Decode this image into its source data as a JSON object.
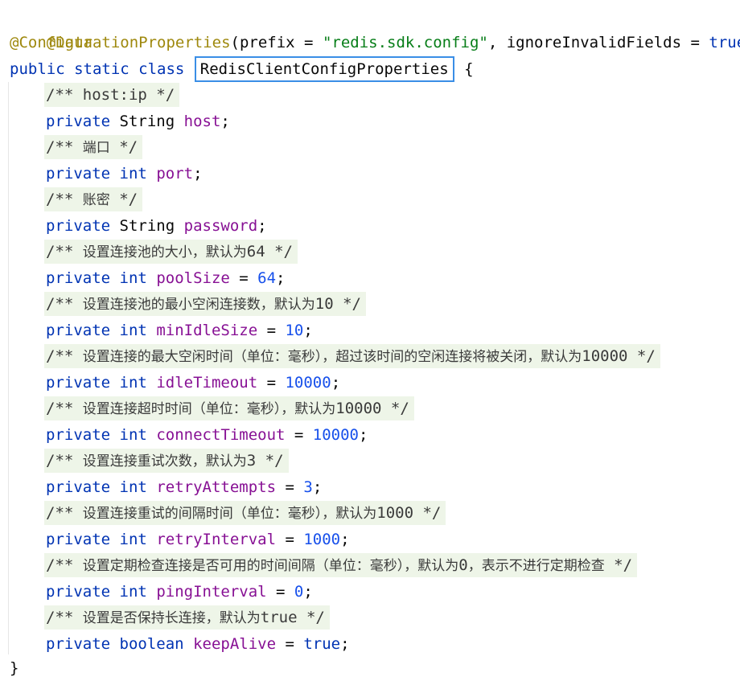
{
  "code": {
    "annotation_data": "@Data",
    "annotation_config": "@ConfigurationProperties",
    "prefix_open": "(prefix = ",
    "prefix_value": "\"redis.sdk.config\"",
    "ignore_part": ", ignoreInvalidFields = ",
    "ignore_value": "true",
    "close_paren": ")",
    "class_modifiers": "public static class ",
    "class_name": "RedisClientConfigProperties",
    "open_brace": " {",
    "close_brace": "}",
    "kw_private": "private",
    "kw_int": "int",
    "kw_boolean": "boolean",
    "type_string": "String",
    "eq": " = ",
    "semi": ";",
    "true_value": "true",
    "c_open": "/** ",
    "c_close": " */",
    "comments": {
      "host": "host:ip",
      "port": "端口",
      "password": "账密",
      "pool_size_text": "设置连接池的大小，默认为",
      "pool_size_num": "64",
      "min_idle_text": "设置连接池的最小空闲连接数，默认为",
      "min_idle_num": "10",
      "idle_timeout_text": "设置连接的最大空闲时间（单位：毫秒），超过该时间的空闲连接将被关闭，默认为",
      "idle_timeout_num": "10000",
      "connect_timeout_text": "设置连接超时时间（单位：毫秒），默认为",
      "connect_timeout_num": "10000",
      "retry_attempts_text": "设置连接重试次数，默认为",
      "retry_attempts_num": "3",
      "retry_interval_text": "设置连接重试的间隔时间（单位：毫秒），默认为",
      "retry_interval_num": "1000",
      "ping_interval_text": "设置定期检查连接是否可用的时间间隔（单位：毫秒），默认为",
      "ping_interval_num": "0",
      "ping_interval_text2": "，表示不进行定期检查",
      "keep_alive_text": "设置是否保持长连接，默认为",
      "keep_alive_num": "true"
    },
    "fields": {
      "host": "host",
      "port": "port",
      "password": "password",
      "pool_size": "poolSize",
      "pool_size_value": "64",
      "min_idle_size": "minIdleSize",
      "min_idle_size_value": "10",
      "idle_timeout": "idleTimeout",
      "idle_timeout_value": "10000",
      "connect_timeout": "connectTimeout",
      "connect_timeout_value": "10000",
      "retry_attempts": "retryAttempts",
      "retry_attempts_value": "3",
      "retry_interval": "retryInterval",
      "retry_interval_value": "1000",
      "ping_interval": "pingInterval",
      "ping_interval_value": "0",
      "keep_alive": "keepAlive",
      "keep_alive_value": "true"
    }
  },
  "colors": {
    "keyword": "#0033b3",
    "annotation": "#9e880d",
    "string": "#067d17",
    "field": "#871094",
    "number": "#1750eb",
    "comment_bg": "#eef5e8",
    "highlight_border": "#3a8ee6"
  }
}
